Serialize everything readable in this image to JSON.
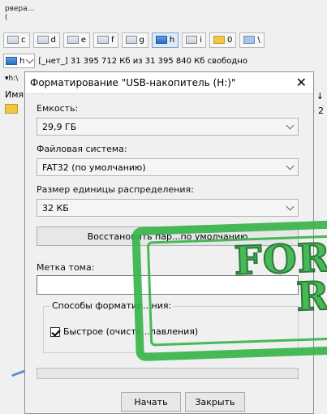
{
  "window": {
    "top_text_1": "рвера...",
    "top_text_2": "("
  },
  "drives": [
    {
      "letter": "c"
    },
    {
      "letter": "d"
    },
    {
      "letter": "e"
    },
    {
      "letter": "f"
    },
    {
      "letter": "g"
    },
    {
      "letter": "h"
    },
    {
      "letter": "i"
    },
    {
      "letter": "0"
    },
    {
      "letter": "\\"
    }
  ],
  "path": {
    "drive": "h",
    "status": "[_нет_]  31 395 712 Кб из 31 395 840 Кб свободно"
  },
  "panel": {
    "header": "▾h:\\",
    "col_name": "Имя",
    "row_prefix": "[",
    "right_col": "↓",
    "right_val": "> 2"
  },
  "dialog": {
    "title": "Форматирование \"USB-накопитель (H:)\"",
    "close": "✕",
    "capacity_label": "Емкость:",
    "capacity_value": "29,9 ГБ",
    "fs_label": "Файловая система:",
    "fs_value": "FAT32 (по умолчанию)",
    "alloc_label": "Размер единицы распределения:",
    "alloc_value": "32 КБ",
    "restore_button": "Восстановить пар...по умолчанию",
    "volume_label": "Метка тома:",
    "format_options_label": "Способы форматир...ния:",
    "quick_format_label": "Быстрое (очистк...лавления)",
    "start_button": "Начать",
    "close_button": "Закрыть"
  },
  "stamp": {
    "line1": "FOR",
    "line2": "RE"
  }
}
